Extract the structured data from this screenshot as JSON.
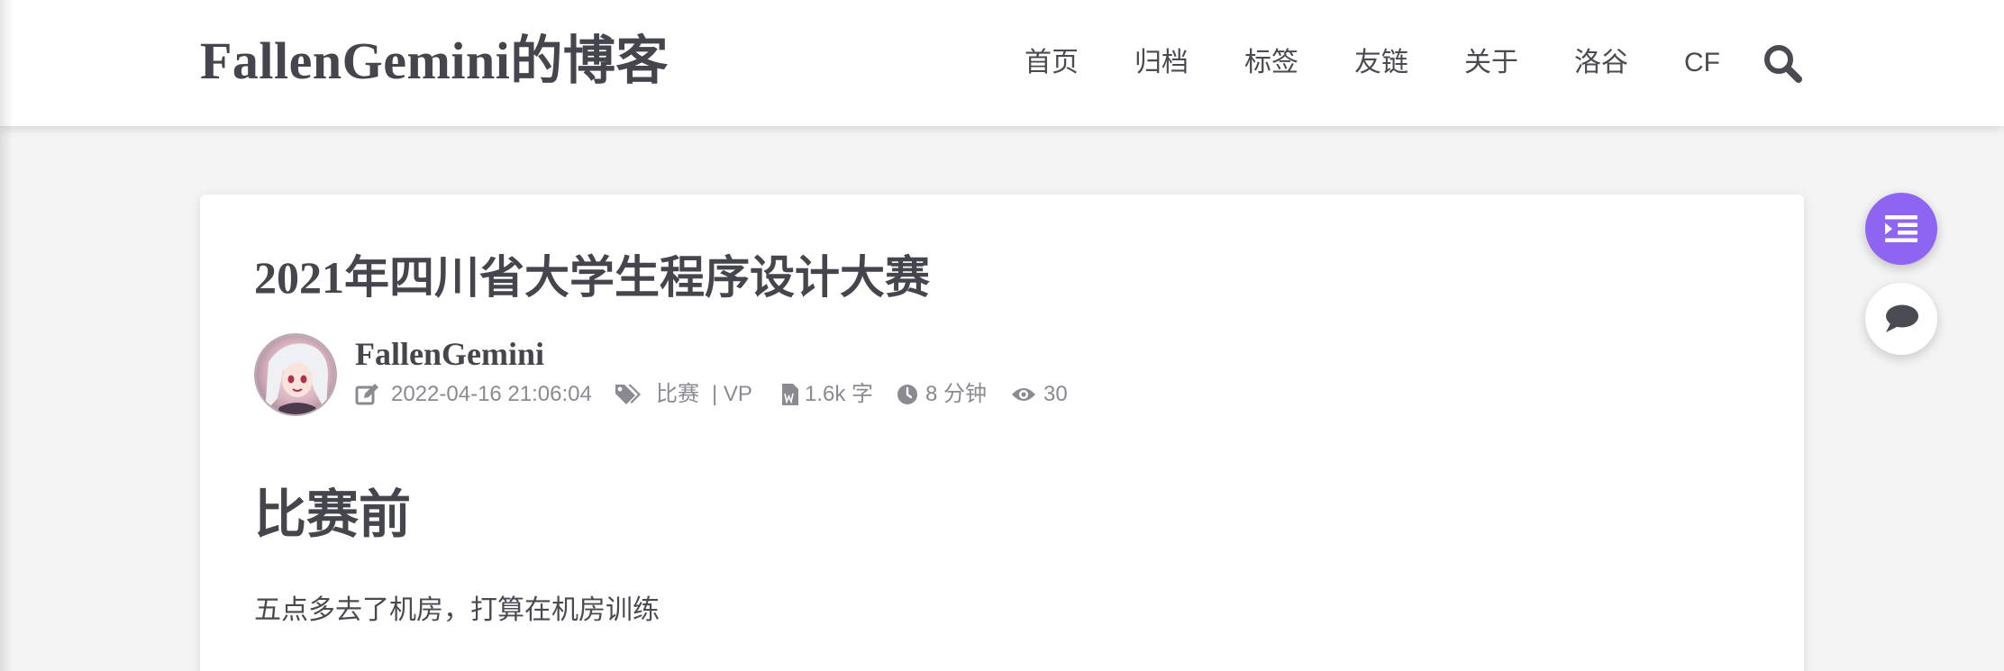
{
  "site": {
    "title": "FallenGemini的博客"
  },
  "nav": {
    "items": [
      {
        "label": "首页"
      },
      {
        "label": "归档"
      },
      {
        "label": "标签"
      },
      {
        "label": "友链"
      },
      {
        "label": "关于"
      },
      {
        "label": "洛谷"
      },
      {
        "label": "CF"
      }
    ],
    "search_icon": "search-icon"
  },
  "post": {
    "title": "2021年四川省大学生程序设计大赛",
    "author": "FallenGemini",
    "meta": {
      "date": "2022-04-16 21:06:04",
      "tag_primary": "比赛",
      "tag_secondary": "| VP",
      "word_count": "1.6k 字",
      "read_time": "8 分钟",
      "views": "30"
    },
    "section_heading": "比赛前",
    "paragraph": "五点多去了机房，打算在机房训练"
  },
  "fab": {
    "toc_icon": "toc-icon",
    "comment_icon": "comment-icon"
  },
  "colors": {
    "accent": "#8e64f2",
    "text": "#45454d",
    "meta": "#8a8a92",
    "background": "#f4f4f5"
  }
}
